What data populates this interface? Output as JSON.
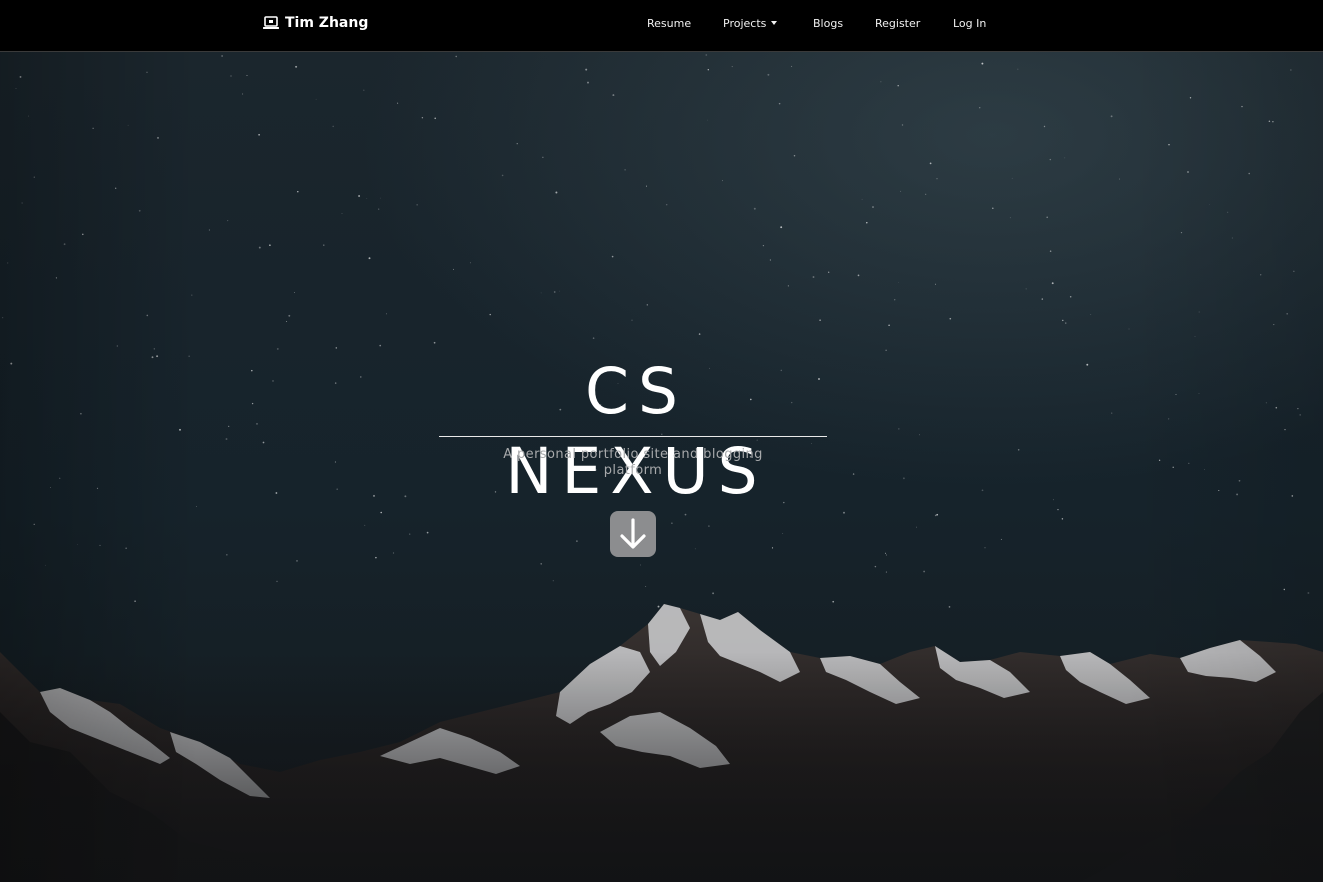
{
  "navbar": {
    "brand_label": "Tim Zhang",
    "brand_icon": "laptop-icon",
    "links": [
      {
        "label": "Resume"
      },
      {
        "label": "Projects",
        "dropdown": true
      },
      {
        "label": "Blogs"
      },
      {
        "label": "Register"
      },
      {
        "label": "Log In"
      }
    ]
  },
  "hero": {
    "title": "CS NEXUS",
    "subtitle": "A personal portfolio site and blogging platform",
    "scroll_button_icon": "arrow-down-icon"
  },
  "colors": {
    "navbar_bg": "#000000",
    "nav_text": "#f1f1f1",
    "title": "#ffffff",
    "subtitle": "#a7a9ab",
    "scroll_button_bg": "#8c8d8f",
    "sky": "#18242c"
  }
}
